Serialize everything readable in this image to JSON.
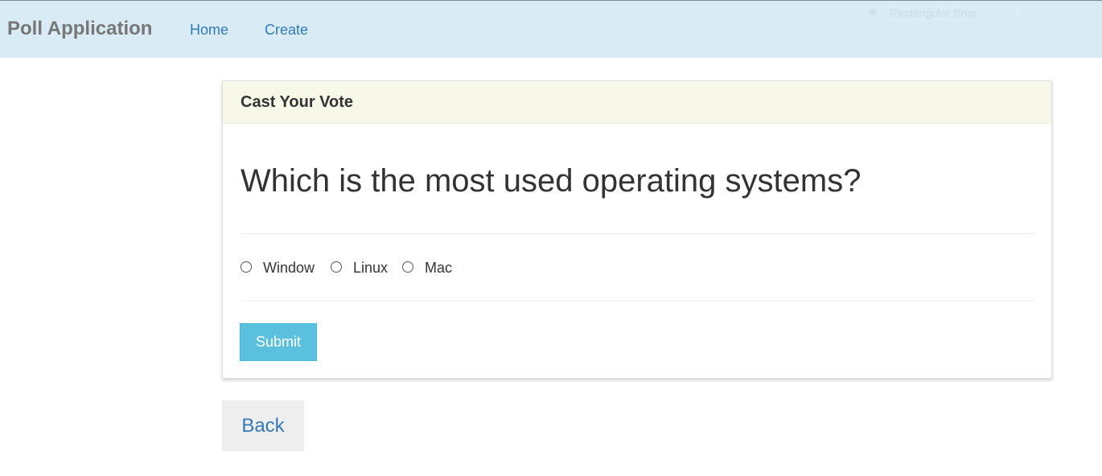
{
  "navbar": {
    "brand": "Poll Application",
    "links": [
      {
        "label": "Home"
      },
      {
        "label": "Create"
      }
    ],
    "overlay_label": "Rectangular Snip"
  },
  "poll": {
    "heading": "Cast Your Vote",
    "question": "Which is the most used operating systems?",
    "options": [
      {
        "label": "Window",
        "checked": false
      },
      {
        "label": "Linux",
        "checked": false
      },
      {
        "label": "Mac",
        "checked": false
      }
    ],
    "submit_label": "Submit"
  },
  "back_label": "Back",
  "colors": {
    "navbar_bg": "#d9ecf5",
    "link": "#337ab7",
    "panel_heading_bg": "#f7f8e7",
    "submit_bg": "#5bc0de",
    "back_bg": "#eeeeee"
  }
}
